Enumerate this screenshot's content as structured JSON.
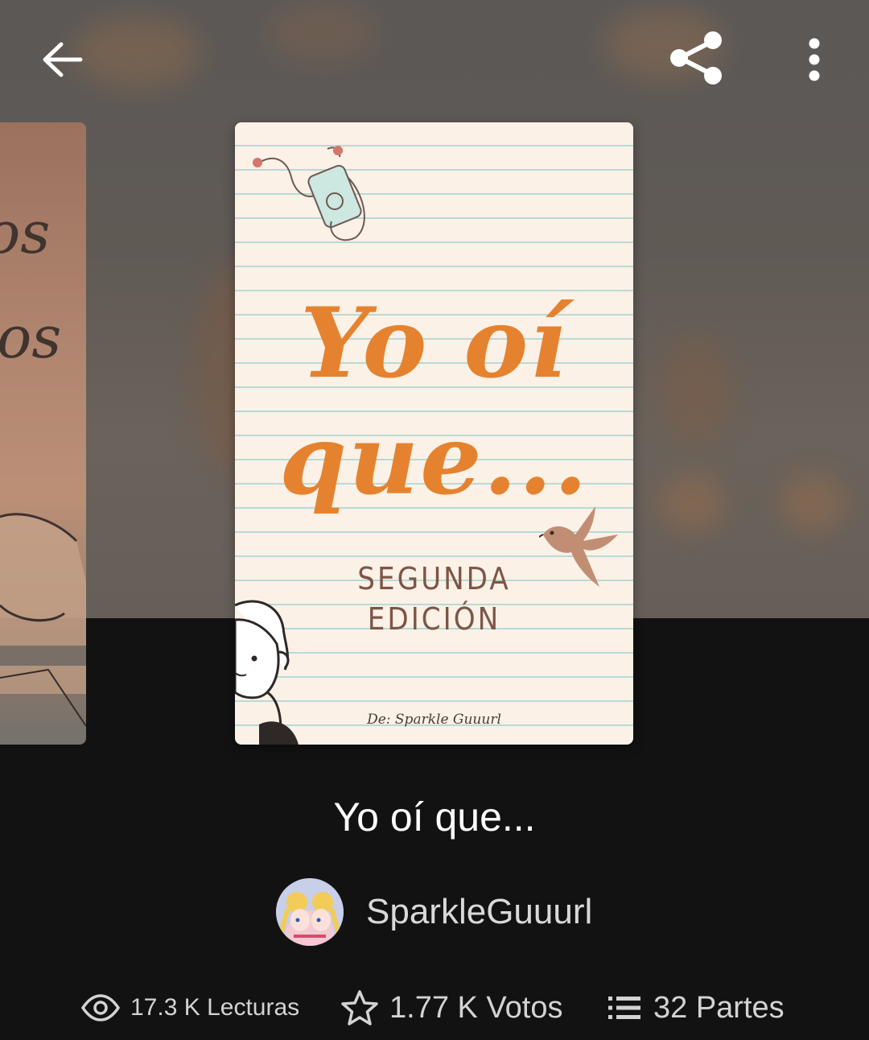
{
  "header": {
    "back_icon": "arrow-left-icon",
    "share_icon": "share-icon",
    "more_icon": "more-vertical-icon"
  },
  "cover": {
    "title_line1": "Yo oí",
    "title_line2": "que...",
    "edition_line1": "SEGUNDA",
    "edition_line2": "EDICIÓN",
    "author_credit": "De: Sparkle Guuurl",
    "peek_text1": "os",
    "peek_text2": "os"
  },
  "story": {
    "title": "Yo oí que...",
    "author": "SparkleGuuurl"
  },
  "stats": {
    "reads": "17.3 K Lecturas",
    "votes": "1.77 K Votos",
    "parts": "32 Partes"
  },
  "colors": {
    "background": "#121212",
    "cover_accent": "#e5822f"
  }
}
